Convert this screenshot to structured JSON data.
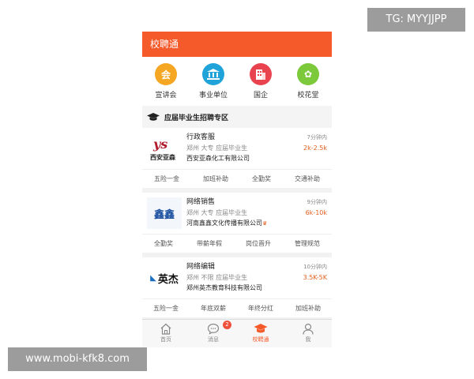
{
  "watermarks": {
    "top": "TG: MYYJJPP",
    "bottom": "www.mobi-kfk8.com"
  },
  "header": {
    "title": "校聘通"
  },
  "categories": [
    {
      "label": "宣讲会",
      "icon": "speech-bubble-icon",
      "icon_text": "会",
      "color": "#f5a623"
    },
    {
      "label": "事业单位",
      "icon": "institution-building-icon",
      "icon_text": "",
      "color": "#1fa3d8"
    },
    {
      "label": "国企",
      "icon": "office-building-icon",
      "icon_text": "",
      "color": "#e8434f"
    },
    {
      "label": "校花堂",
      "icon": "flower-icon",
      "icon_text": "✿",
      "color": "#7cc93c"
    }
  ],
  "section": {
    "title": "应届毕业生招聘专区",
    "icon": "graduation-cap-icon"
  },
  "jobs": [
    {
      "title": "行政客服",
      "meta": "郑州 大专 应届毕业生",
      "company": "西安亚森化工有限公司",
      "time": "7分钟内",
      "salary": "2k-2.5k",
      "logo_text": "西安亚森",
      "perks": [
        "五险一金",
        "加班补助",
        "全勤奖",
        "交通补助"
      ]
    },
    {
      "title": "网络销售",
      "meta": "郑州 大专 应届毕业生",
      "company": "河南鑫鑫文化传播有限公司",
      "time": "9分钟内",
      "salary": "6k-10k",
      "logo_text": "鑫鑫",
      "perks": [
        "全勤奖",
        "带薪年假",
        "岗位晋升",
        "管理规范"
      ]
    },
    {
      "title": "网络编辑",
      "meta": "郑州 不限 应届毕业生",
      "company": "郑州英杰教育科技有限公司",
      "time": "10分钟内",
      "salary": "3.5K-5K",
      "logo_text": "英杰",
      "perks": [
        "五险一金",
        "年底双薪",
        "年终分红",
        "加班补助"
      ]
    }
  ],
  "tabbar": [
    {
      "label": "首页",
      "icon": "home-icon"
    },
    {
      "label": "消息",
      "icon": "message-icon",
      "badge": "2"
    },
    {
      "label": "校聘通",
      "icon": "graduation-cap-icon",
      "active": true
    },
    {
      "label": "我",
      "icon": "user-icon"
    }
  ],
  "colors": {
    "accent": "#f55a2a",
    "salary": "#e0601f"
  }
}
